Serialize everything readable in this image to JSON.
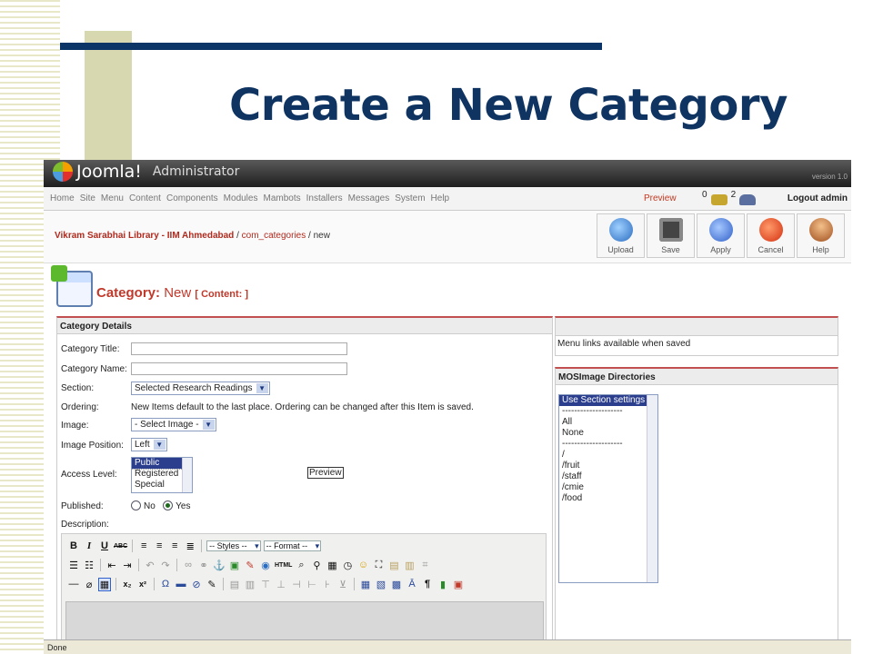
{
  "slide": {
    "title": "Create a New Category"
  },
  "app": {
    "brand": "Joomla!",
    "subtitle": "Administrator",
    "version": "version 1.0"
  },
  "menu": {
    "items": [
      "Home",
      "Site",
      "Menu",
      "Content",
      "Components",
      "Modules",
      "Mambots",
      "Installers",
      "Messages",
      "System",
      "Help"
    ],
    "preview": "Preview",
    "messages_count": "0",
    "users_count": "2",
    "logout": "Logout admin"
  },
  "breadcrumb": {
    "site": "Vikram Sarabhai Library - IIM Ahmedabad",
    "sep1": "/",
    "component": "com_categories",
    "sep2": "/ new"
  },
  "toolbar": {
    "upload": "Upload",
    "save": "Save",
    "apply": "Apply",
    "cancel": "Cancel",
    "help": "Help"
  },
  "page": {
    "title_prefix": "Category:",
    "title_mode": "New",
    "title_suffix": "[ Content: ]"
  },
  "details": {
    "header": "Category Details",
    "category_title_label": "Category Title:",
    "category_title_value": "",
    "category_name_label": "Category Name:",
    "category_name_value": "",
    "section_label": "Section:",
    "section_value": "Selected Research Readings",
    "ordering_label": "Ordering:",
    "ordering_text": "New Items default to the last place. Ordering can be changed after this Item is saved.",
    "image_label": "Image:",
    "image_value": "- Select Image -",
    "image_position_label": "Image Position:",
    "image_position_value": "Left",
    "access_label": "Access Level:",
    "access_options": [
      "Public",
      "Registered",
      "Special"
    ],
    "preview_button": "Preview",
    "published_label": "Published:",
    "published_no": "No",
    "published_yes": "Yes",
    "description_label": "Description:"
  },
  "editor": {
    "styles": "-- Styles --",
    "format": "-- Format --"
  },
  "right": {
    "menu_links_text": "Menu links available when saved",
    "mosimage_header": "MOSImage Directories",
    "directories": [
      "Use Section settings",
      "--------------------",
      "All",
      "None",
      "--------------------",
      "/",
      "/fruit",
      "/staff",
      "/cmie",
      "/food"
    ]
  },
  "status": {
    "text": "Done"
  }
}
